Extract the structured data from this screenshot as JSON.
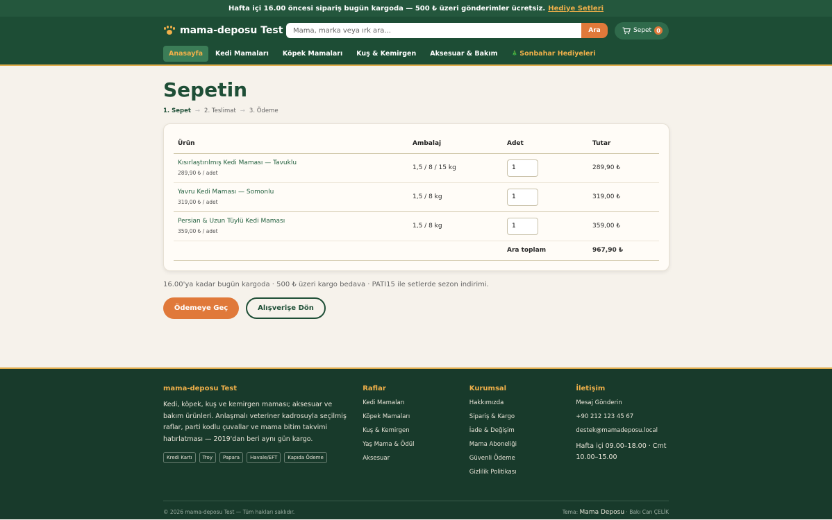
{
  "topbar": {
    "text": "Hafta içi 16.00 öncesi sipariş bugün kargoda — 500 ₺ üzeri gönderimler ücretsiz.",
    "link": "Hediye Setleri"
  },
  "header": {
    "brand": "mama-deposu Test",
    "search_placeholder": "Mama, marka veya ırk ara...",
    "search_button": "Ara",
    "cart_label": "Sepet",
    "cart_count": "0"
  },
  "nav": {
    "items": [
      "Anasayfa",
      "Kedi Mamaları",
      "Köpek Mamaları",
      "Kuş & Kemirgen",
      "Aksesuar & Bakım"
    ],
    "gift_icon": "🎄",
    "gift": "Sonbahar Hediyeleri"
  },
  "page": {
    "title": "Sepetin",
    "steps": [
      "1. Sepet",
      "2. Teslimat",
      "3. Ödeme"
    ],
    "arrow": "→"
  },
  "cart_table": {
    "headers": [
      "Ürün",
      "Ambalaj",
      "Adet",
      "Tutar"
    ],
    "rows": [
      {
        "name": "Kısırlaştırılmış Kedi Maması — Tavuklu",
        "unit": "289,90 ₺ / adet",
        "pack": "1,5 / 8 / 15 kg",
        "qty": "1",
        "total": "289,90 ₺"
      },
      {
        "name": "Yavru Kedi Maması — Somonlu",
        "unit": "319,00 ₺ / adet",
        "pack": "1,5 / 8 kg",
        "qty": "1",
        "total": "319,00 ₺"
      },
      {
        "name": "Persian & Uzun Tüylü Kedi Maması",
        "unit": "359,00 ₺ / adet",
        "pack": "1,5 / 8 kg",
        "qty": "1",
        "total": "359,00 ₺"
      }
    ],
    "subtotal_label": "Ara toplam",
    "subtotal": "967,90 ₺"
  },
  "note": "16.00'ya kadar bugün kargoda · 500 ₺ üzeri kargo bedava · PATI15 ile setlerde sezon indirimi.",
  "buttons": {
    "checkout": "Ödemeye Geç",
    "continue": "Alışverişe Dön"
  },
  "footer": {
    "brand_title": "mama-deposu Test",
    "description": "Kedi, köpek, kuş ve kemirgen maması; aksesuar ve bakım ürünleri. Anlaşmalı veteriner kadrosuyla seçilmiş raflar, parti kodlu çuvallar ve mama bitim takvimi hatırlatması — 2019'dan beri aynı gün kargo.",
    "payments": [
      "Kredi Kartı",
      "Troy",
      "Papara",
      "Havale/EFT",
      "Kapıda Ödeme"
    ],
    "shelves_title": "Raflar",
    "shelves": [
      "Kedi Mamaları",
      "Köpek Mamaları",
      "Kuş & Kemirgen",
      "Yaş Mama & Ödül",
      "Aksesuar"
    ],
    "corporate_title": "Kurumsal",
    "corporate": [
      "Hakkımızda",
      "Sipariş & Kargo",
      "İade & Değişim",
      "Mama Aboneliği",
      "Güvenli Ödeme",
      "Gizlilik Politikası"
    ],
    "contact_title": "İletişim",
    "contact_message": "Mesaj Gönderin",
    "contact_phone": "+90 212 123 45 67",
    "contact_email": "destek@mamadeposu.local",
    "contact_hours": "Hafta içi 09.00–18.00 · Cmt 10.00–15.00",
    "copyright": "© 2026 mama-deposu Test — Tüm hakları saklıdır.",
    "theme_prefix": "Tema:",
    "theme_name": "Mama Deposu",
    "theme_author": "· Bakı Can ÇELİK"
  },
  "colors": {
    "primary_green": "#1d4d35",
    "accent_orange": "#e0793a",
    "accent_gold": "#f0b04a",
    "footer_bg": "#183a2b"
  }
}
